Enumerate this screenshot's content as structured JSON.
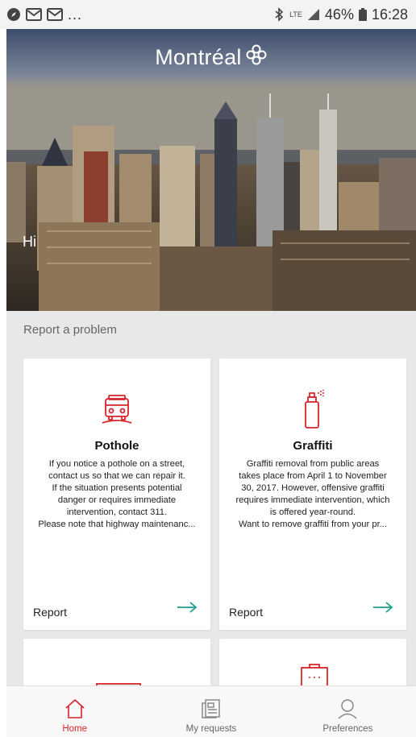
{
  "status_bar": {
    "left_more": "...",
    "network": "LTE",
    "battery": "46%",
    "time": "16:28"
  },
  "hero": {
    "logo_text": "Montréal",
    "greeting": "Hi"
  },
  "section": {
    "title": "Report a problem"
  },
  "cards": [
    {
      "title": "Pothole",
      "icon": "car-front-icon",
      "description_lines": [
        "If you notice a pothole on a street,",
        "contact us so that we can repair it.",
        "If the situation presents potential",
        "danger or requires immediate",
        "intervention, contact 311.",
        "Please note that highway maintenanc..."
      ],
      "report_label": "Report"
    },
    {
      "title": "Graffiti",
      "icon": "spray-can-icon",
      "description_lines": [
        "Graffiti removal from public areas",
        "takes place from April 1 to November",
        "30, 2017. However, offensive graffiti",
        "requires immediate intervention, which",
        "is offered year-round.",
        "Want to remove graffiti from your pr..."
      ],
      "report_label": "Report"
    }
  ],
  "bottom_nav": [
    {
      "label": "Home",
      "icon": "home-icon",
      "active": true
    },
    {
      "label": "My requests",
      "icon": "requests-icon",
      "active": false
    },
    {
      "label": "Preferences",
      "icon": "person-icon",
      "active": false
    }
  ],
  "colors": {
    "brand_red": "#d8232a",
    "accent_teal": "#1a9e8f"
  }
}
